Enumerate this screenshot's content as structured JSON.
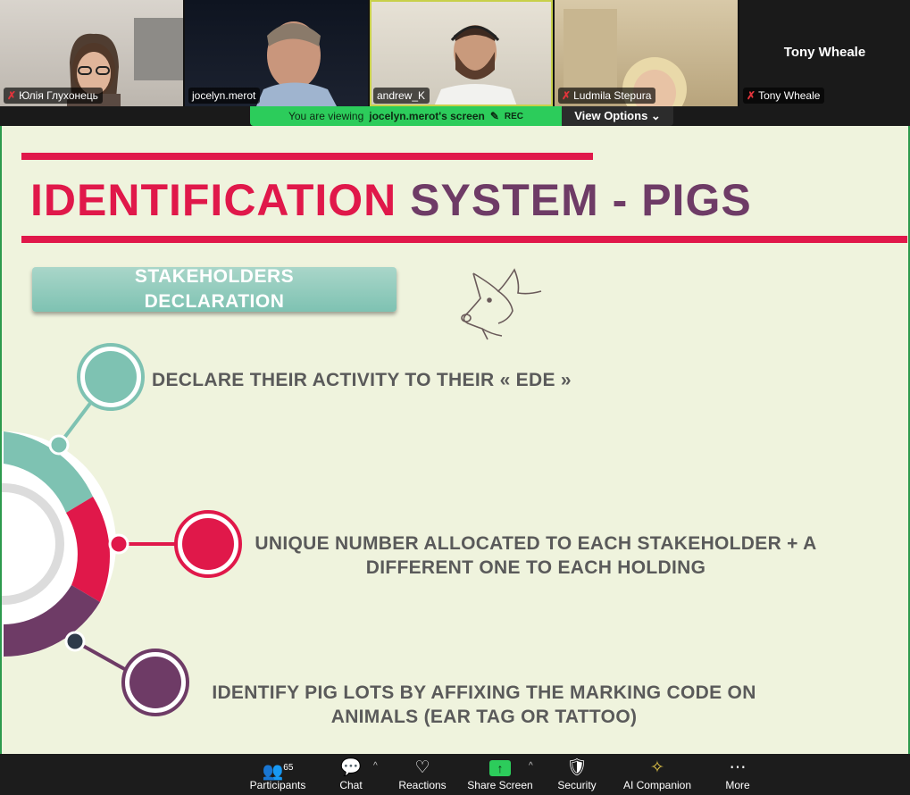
{
  "participants_strip": [
    {
      "name": "Юлія Глухонець",
      "muted": true
    },
    {
      "name": "jocelyn.merot",
      "muted": false
    },
    {
      "name": "andrew_K",
      "muted": false
    },
    {
      "name": "Ludmila Stepura",
      "muted": true
    },
    {
      "name": "Tony Wheale",
      "muted": true,
      "display_name": "Tony Wheale"
    }
  ],
  "banner": {
    "prefix": "You are viewing",
    "owner": "jocelyn.merot's screen",
    "rec": "REC",
    "view_options": "View Options ⌄"
  },
  "slide": {
    "title_part1": "IDENTIFICATION",
    "title_part2": "SYSTEM - PIGS",
    "stake_line1": "STAKEHOLDERS",
    "stake_line2": "DECLARATION",
    "item1": "DECLARE THEIR ACTIVITY TO THEIR  « EDE »",
    "item2_line1": "UNIQUE NUMBER ALLOCATED TO EACH STAKEHOLDER + A",
    "item2_line2": "DIFFERENT ONE TO EACH HOLDING",
    "item3_line1": "IDENTIFY PIG LOTS BY AFFIXING THE MARKING CODE ON",
    "item3_line2": "ANIMALS (EAR TAG OR TATTOO)",
    "colors": {
      "red": "#e0184a",
      "purple": "#6e3b66",
      "teal": "#7ec2b2",
      "background": "#eff3dd"
    }
  },
  "toolbar": {
    "participants": {
      "label": "Participants",
      "count": "65"
    },
    "chat": {
      "label": "Chat"
    },
    "reactions": {
      "label": "Reactions"
    },
    "share": {
      "label": "Share Screen"
    },
    "security": {
      "label": "Security"
    },
    "ai": {
      "label": "AI Companion"
    },
    "more": {
      "label": "More"
    }
  }
}
